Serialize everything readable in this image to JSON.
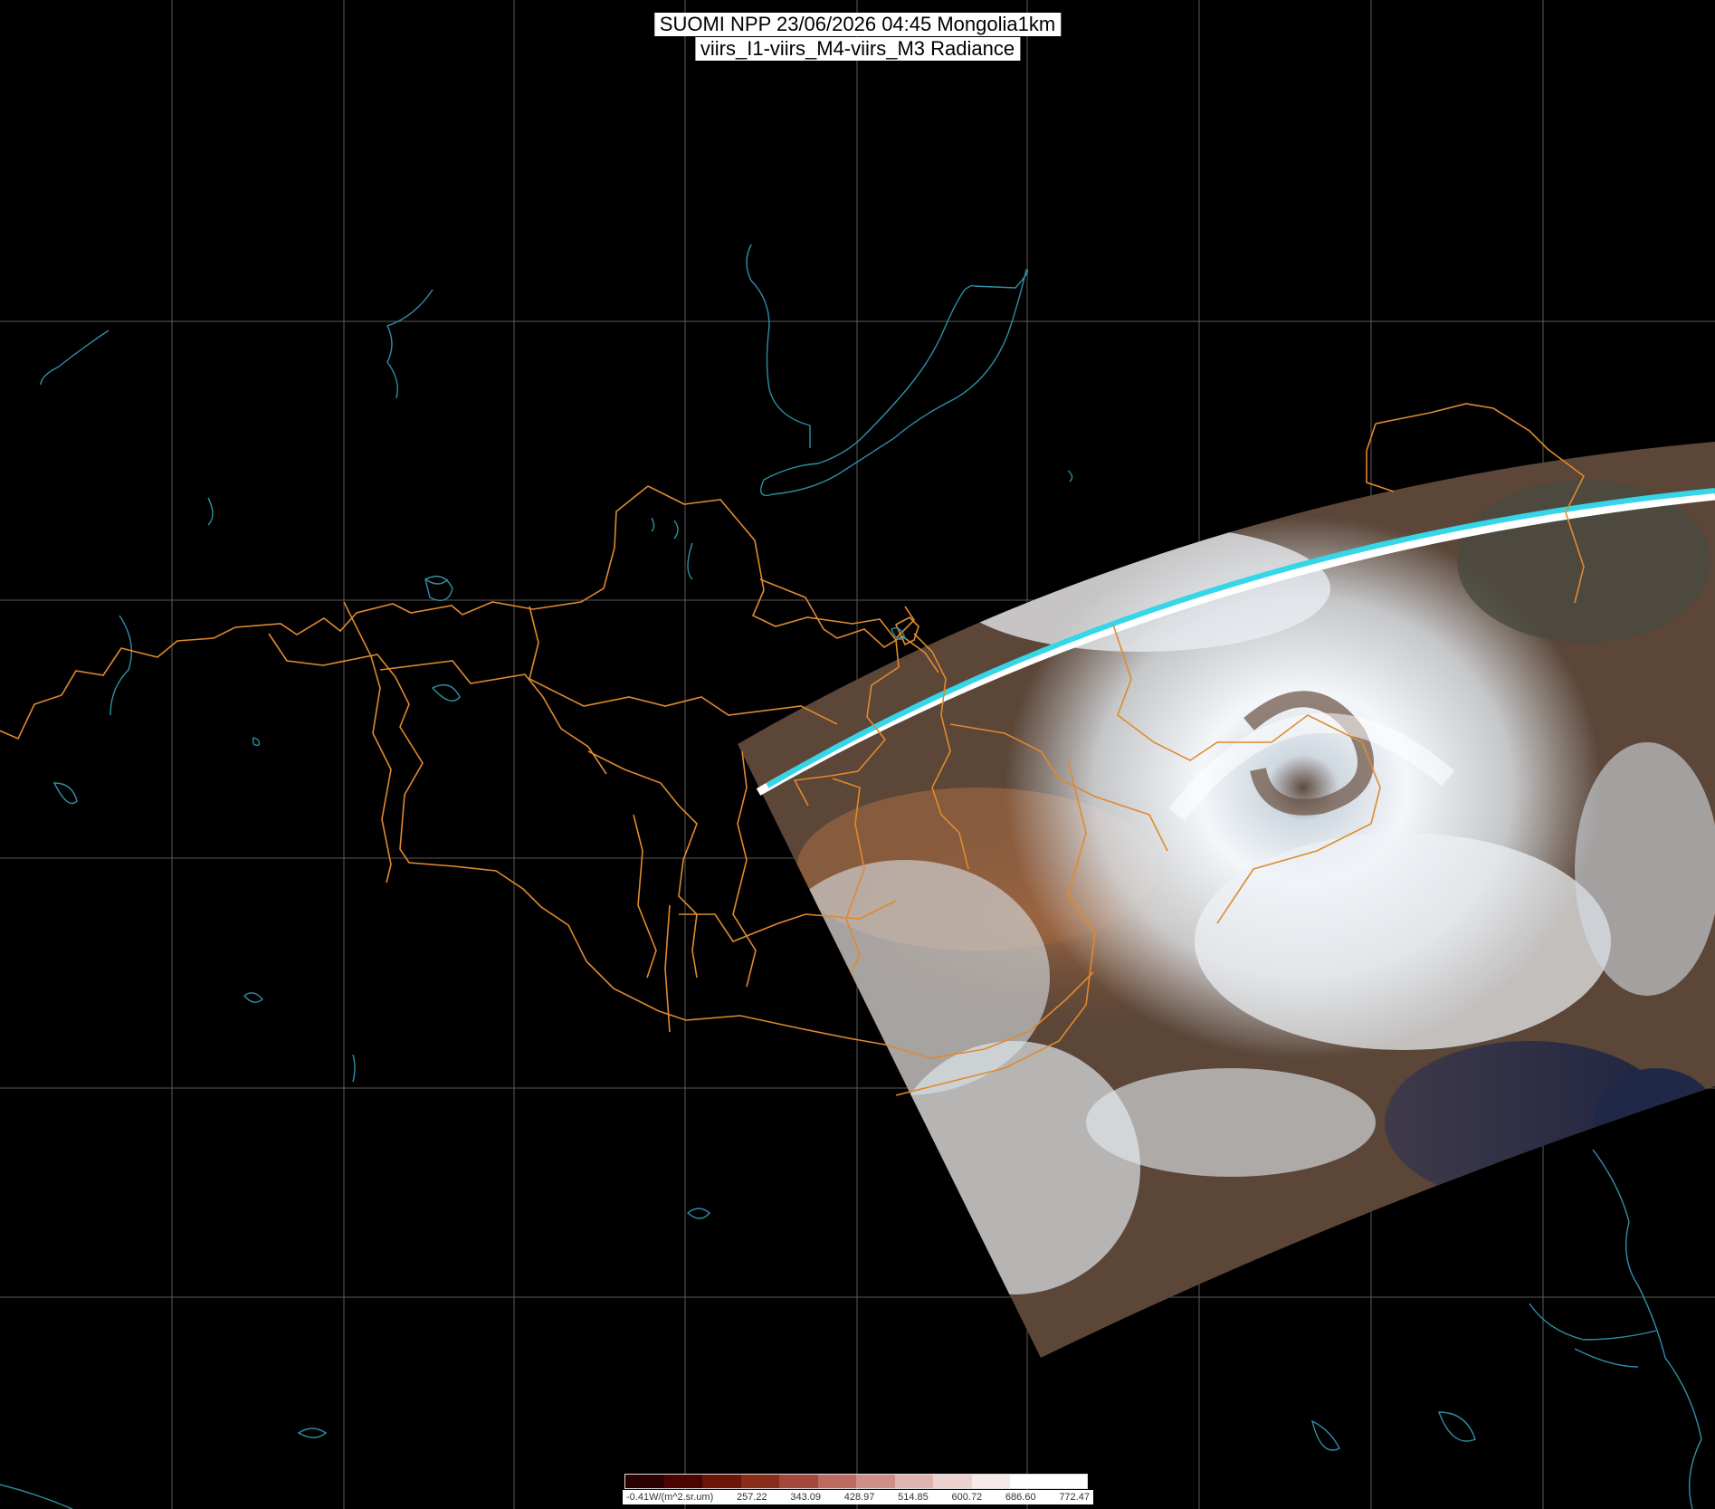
{
  "header": {
    "line1": "SUOMI NPP 23/06/2026 04:45 Mongolia1km",
    "line2": "viirs_I1-viirs_M4-viirs_M3 Radiance"
  },
  "legend": {
    "labels": [
      "-0.41W/(m^2.sr.um)",
      "257.22",
      "343.09",
      "428.97",
      "514.85",
      "600.72",
      "686.60",
      "772.47"
    ],
    "colors": [
      "#2a0000",
      "#4a0500",
      "#6b1408",
      "#8a2c1a",
      "#a5473a",
      "#bd6a60",
      "#cf8f88",
      "#dfb3ae",
      "#ecd2cf",
      "#f6eae8",
      "#ffffff",
      "#ffffff"
    ]
  },
  "colors": {
    "border": "#e08a2e",
    "coast": "#2f8fa6",
    "grid": "#5a5a5a",
    "swath_edge": "#35d6e8",
    "cloud": "#f2f6fa",
    "land": "#7a5540"
  }
}
